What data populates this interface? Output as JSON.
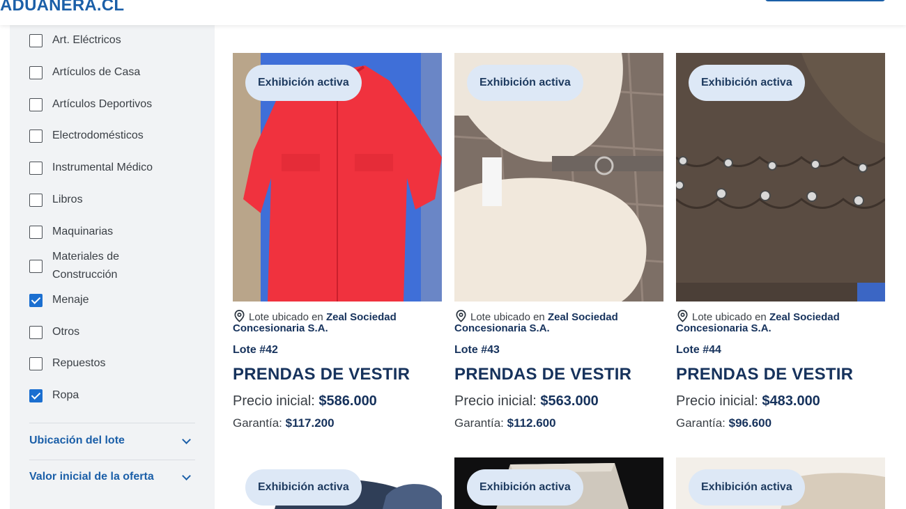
{
  "header": {
    "logo": "ADUANERA.CL"
  },
  "sidebar": {
    "filters": [
      {
        "label": "Art. Eléctricos",
        "checked": false
      },
      {
        "label": "Artículos de Casa",
        "checked": false
      },
      {
        "label": "Artículos Deportivos",
        "checked": false
      },
      {
        "label": "Electrodomésticos",
        "checked": false
      },
      {
        "label": "Instrumental Médico",
        "checked": false
      },
      {
        "label": "Libros",
        "checked": false
      },
      {
        "label": "Maquinarias",
        "checked": false
      },
      {
        "label": "Materiales de",
        "label2": "Construcción",
        "checked": false
      },
      {
        "label": "Menaje",
        "checked": true
      },
      {
        "label": "Otros",
        "checked": false
      },
      {
        "label": "Repuestos",
        "checked": false
      },
      {
        "label": "Ropa",
        "checked": true
      }
    ],
    "accordions": [
      {
        "label": "Ubicación del lote"
      },
      {
        "label": "Valor inicial de la oferta"
      }
    ]
  },
  "cards": [
    {
      "badge": "Exhibición activa",
      "loc_prefix": "Lote ubicado en",
      "loc_name": "Zeal Sociedad",
      "loc_name2": "Concesionaria S.A.",
      "lote": "Lote #42",
      "title": "PRENDAS DE VESTIR",
      "price_label": "Precio inicial:",
      "price": "$586.000",
      "guarantee_label": "Garantía:",
      "guarantee": "$117.200"
    },
    {
      "badge": "Exhibición activa",
      "loc_prefix": "Lote ubicado en",
      "loc_name": "Zeal Sociedad",
      "loc_name2": "Concesionaria S.A.",
      "lote": "Lote #43",
      "title": "PRENDAS DE VESTIR",
      "price_label": "Precio inicial:",
      "price": "$563.000",
      "guarantee_label": "Garantía:",
      "guarantee": "$112.600"
    },
    {
      "badge": "Exhibición activa",
      "loc_prefix": "Lote ubicado en",
      "loc_name": "Zeal Sociedad",
      "loc_name2": "Concesionaria S.A.",
      "lote": "Lote #44",
      "title": "PRENDAS DE VESTIR",
      "price_label": "Precio inicial:",
      "price": "$483.000",
      "guarantee_label": "Garantía:",
      "guarantee": "$96.600"
    }
  ],
  "cards_row2": [
    {
      "badge": "Exhibición activa"
    },
    {
      "badge": "Exhibición activa"
    },
    {
      "badge": "Exhibición activa"
    }
  ],
  "colors": {
    "brand": "#1b5fa8",
    "badge_bg": "#dde8f6",
    "checkbox_checked": "#1b6fd0",
    "sidebar_bg": "#f1f3f5"
  }
}
